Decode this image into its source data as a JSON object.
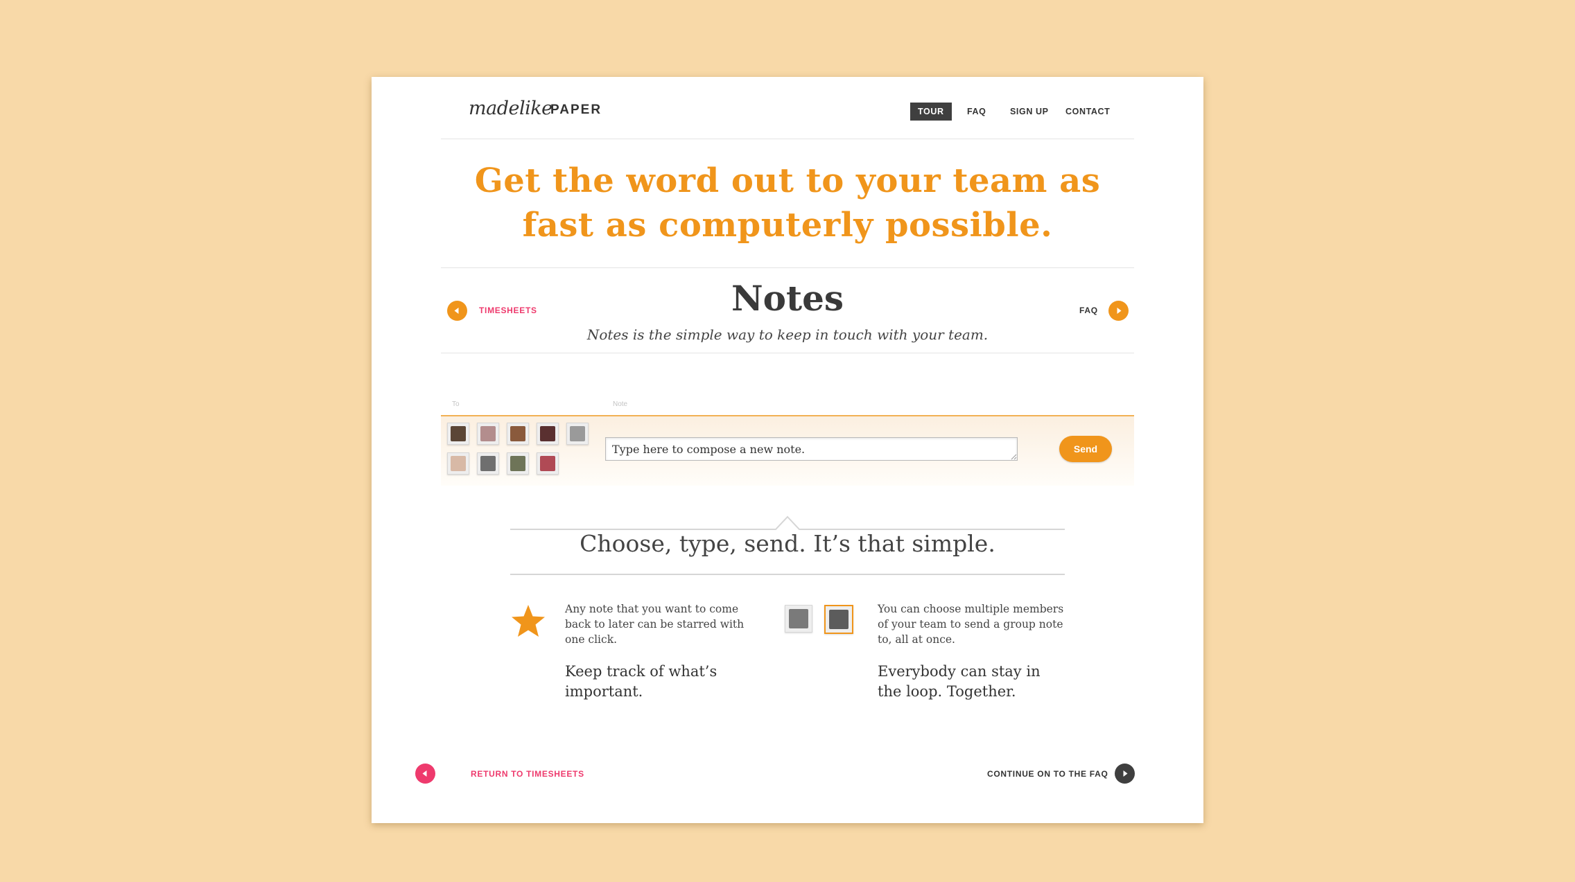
{
  "header": {
    "logo_script": "madelike",
    "logo_word": "PAPER",
    "nav": [
      "TOUR",
      "FAQ",
      "SIGN UP",
      "CONTACT"
    ]
  },
  "headline": [
    "Get the word out to your team as",
    "fast as computerly possible."
  ],
  "section": {
    "prev_label": "TIMESHEETS",
    "next_label": "FAQ",
    "title": "Notes",
    "subtitle": "Notes is the simple way to keep in touch with your team."
  },
  "composer": {
    "to_label": "To",
    "note_label": "Note",
    "note_value": "Type here to compose a new note.",
    "send_label": "Send"
  },
  "tagline": "Choose, type, send. It’s that simple.",
  "features": [
    {
      "icon": "star-icon",
      "small": "Any note that you want to come back to later can be starred with one click.",
      "large": "Keep track of what’s important."
    },
    {
      "icon": "avatars-icon",
      "small": "You can choose multiple members of your team to send a group note to, all at once.",
      "large": "Everybody can stay in the loop. Together."
    }
  ],
  "footer": {
    "prev_label": "RETURN TO TIMESHEETS",
    "next_label": "CONTINUE ON TO THE FAQ"
  },
  "colors": {
    "accent": "#f0951b",
    "pink": "#ee3a6d",
    "dark": "#3f3f3f",
    "bg": "#f8d9a8"
  }
}
